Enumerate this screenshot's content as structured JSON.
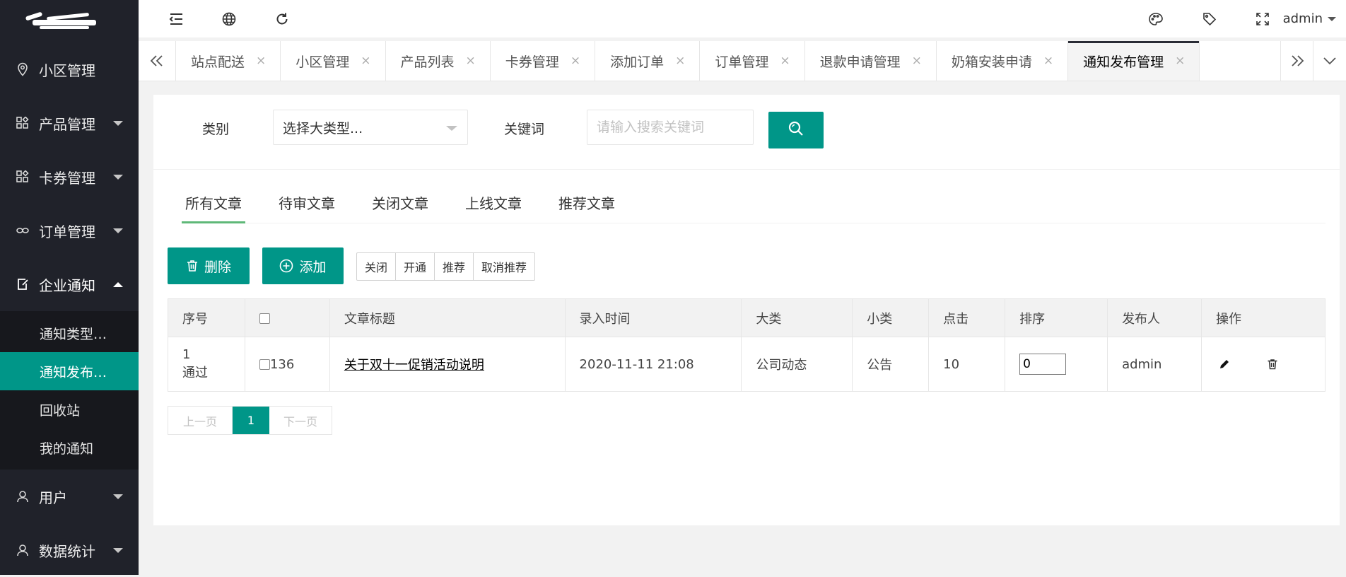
{
  "sidebar": {
    "menu": [
      {
        "label": "小区管理",
        "icon": "location-pin-icon",
        "caret": false
      },
      {
        "label": "产品管理",
        "icon": "apps-grid-icon",
        "caret": true
      },
      {
        "label": "卡券管理",
        "icon": "apps-grid-icon",
        "caret": true
      },
      {
        "label": "订单管理",
        "icon": "link-chain-icon",
        "caret": true
      },
      {
        "label": "企业通知",
        "icon": "edit-note-icon",
        "caret": true,
        "open": true
      },
      {
        "label": "用户",
        "icon": "user-icon",
        "caret": true
      },
      {
        "label": "数据统计",
        "icon": "user-icon",
        "caret": true
      }
    ],
    "notice_submenu": [
      {
        "label": "通知类型…"
      },
      {
        "label": "通知发布…",
        "active": true
      },
      {
        "label": "回收站"
      },
      {
        "label": "我的通知"
      }
    ]
  },
  "header": {
    "icons": [
      "collapse-menu-icon",
      "globe-icon",
      "refresh-icon",
      "theme-palette-icon",
      "tag-icon",
      "fullscreen-icon"
    ],
    "user": "admin"
  },
  "tabs": {
    "items": [
      "站点配送",
      "小区管理",
      "产品列表",
      "卡券管理",
      "添加订单",
      "订单管理",
      "退款申请管理",
      "奶箱安装申请",
      "通知发布管理"
    ],
    "active_index": 8,
    "close_glyph": "×"
  },
  "search": {
    "category_label": "类别",
    "category_value": "选择大类型...",
    "keyword_label": "关键词",
    "keyword_placeholder": "请输入搜索关键词"
  },
  "article_tabs": [
    "所有文章",
    "待审文章",
    "关闭文章",
    "上线文章",
    "推荐文章"
  ],
  "toolbar": {
    "delete_label": "删除",
    "add_label": "添加",
    "group": [
      "关闭",
      "开通",
      "推荐",
      "取消推荐"
    ]
  },
  "table": {
    "headers": [
      "序号",
      "",
      "文章标题",
      "录入时间",
      "大类",
      "小类",
      "点击",
      "排序",
      "发布人",
      "操作"
    ],
    "rows": [
      {
        "seq": "1",
        "status": "通过",
        "id": "136",
        "title": "关于双十一促销活动说明",
        "time": "2020-11-11 21:08",
        "category": "公司动态",
        "subcategory": "公告",
        "clicks": "10",
        "sort": "0",
        "publisher": "admin"
      }
    ]
  },
  "pager": {
    "prev": "上一页",
    "current": "1",
    "next": "下一页"
  },
  "colors": {
    "accent": "#009688",
    "sidebar_bg": "#20222a",
    "submenu_bg": "#17181d",
    "tab_underline": "#5fb878"
  }
}
